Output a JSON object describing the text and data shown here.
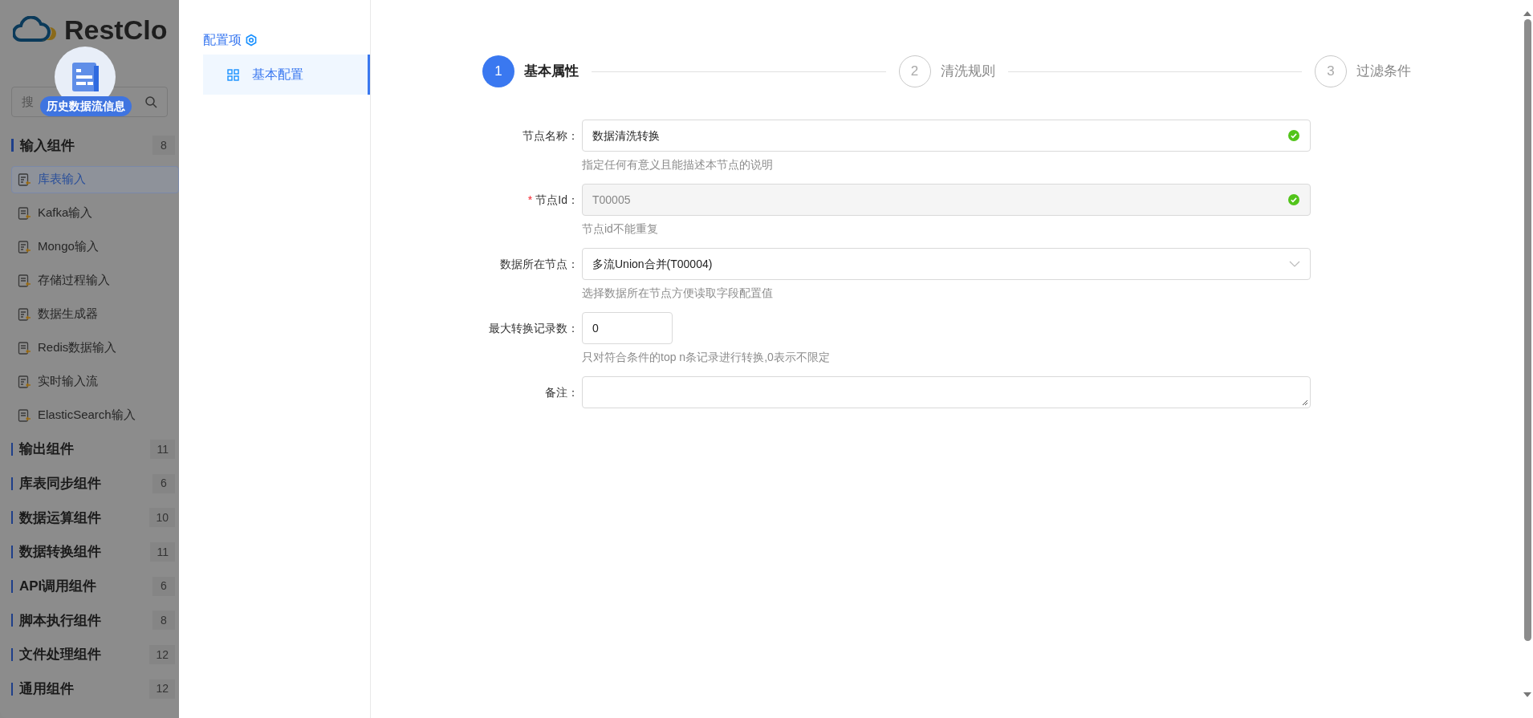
{
  "sidebar": {
    "logo_text": "RestClo",
    "floating_badge": "历史数据流信息",
    "search": {
      "placeholder": "搜"
    },
    "groups": [
      {
        "label": "输入组件",
        "count": "8",
        "expanded": true,
        "items": [
          {
            "label": "库表输入",
            "selected": true
          },
          {
            "label": "Kafka输入",
            "selected": false
          },
          {
            "label": "Mongo输入",
            "selected": false
          },
          {
            "label": "存储过程输入",
            "selected": false
          },
          {
            "label": "数据生成器",
            "selected": false
          },
          {
            "label": "Redis数据输入",
            "selected": false
          },
          {
            "label": "实时输入流",
            "selected": false
          },
          {
            "label": "ElasticSearch输入",
            "selected": false
          }
        ]
      },
      {
        "label": "输出组件",
        "count": "11",
        "expanded": false
      },
      {
        "label": "库表同步组件",
        "count": "6",
        "expanded": false
      },
      {
        "label": "数据运算组件",
        "count": "10",
        "expanded": false
      },
      {
        "label": "数据转换组件",
        "count": "11",
        "expanded": false
      },
      {
        "label": "API调用组件",
        "count": "6",
        "expanded": false
      },
      {
        "label": "脚本执行组件",
        "count": "8",
        "expanded": false
      },
      {
        "label": "文件处理组件",
        "count": "12",
        "expanded": false
      },
      {
        "label": "通用组件",
        "count": "12",
        "expanded": false
      }
    ]
  },
  "config_menu": {
    "title": "配置项",
    "items": [
      {
        "label": "基本配置",
        "selected": true
      }
    ]
  },
  "steps": [
    {
      "number": "1",
      "label": "基本属性",
      "selected": true
    },
    {
      "number": "2",
      "label": "清洗规则",
      "selected": false
    },
    {
      "number": "3",
      "label": "过滤条件",
      "selected": false
    }
  ],
  "form": [
    {
      "kind": "text",
      "label": "节点名称：",
      "value": "数据清洗转换",
      "valid": true,
      "disabled": false,
      "help": "指定任何有意义且能描述本节点的说明"
    },
    {
      "kind": "text",
      "label": "节点Id：",
      "required_mark": "*",
      "value": "T00005",
      "valid": true,
      "disabled": true,
      "help": "节点id不能重复"
    },
    {
      "kind": "select",
      "label": "数据所在节点：",
      "value": "多流Union合并(T00004)",
      "help": "选择数据所在节点方便读取字段配置值"
    },
    {
      "kind": "number",
      "label": "最大转换记录数：",
      "value": "0",
      "help": "只对符合条件的top n条记录进行转换,0表示不限定"
    },
    {
      "kind": "textarea",
      "label": "备注："
    }
  ]
}
